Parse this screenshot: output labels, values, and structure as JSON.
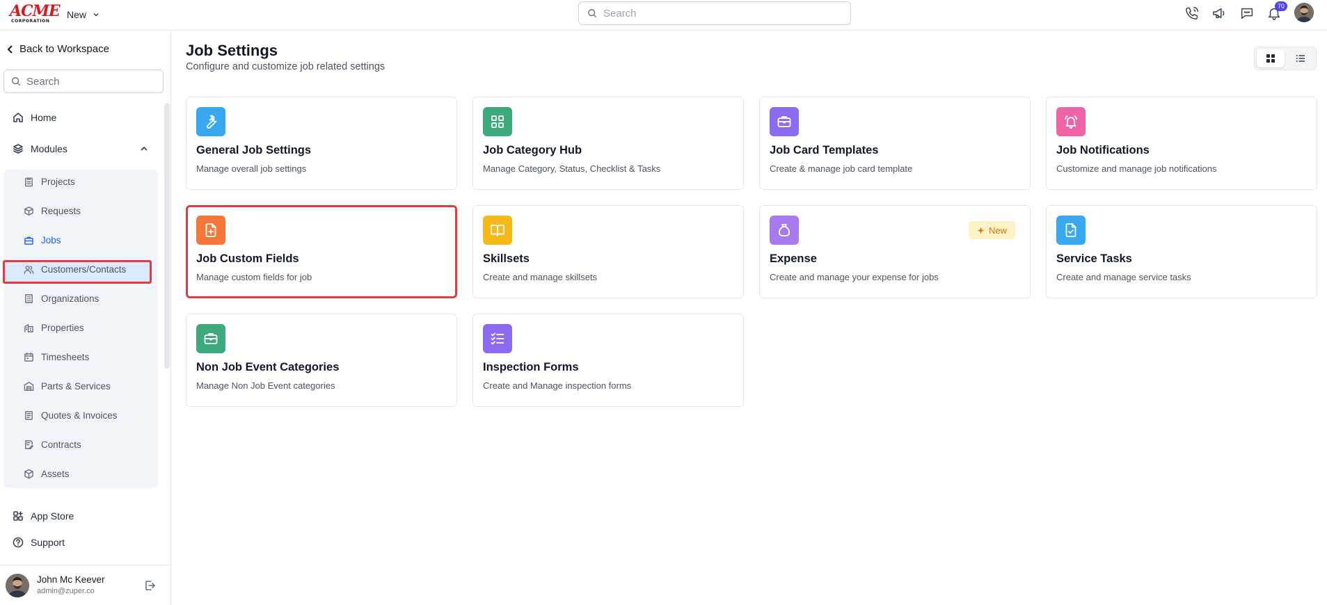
{
  "topbar": {
    "logo_main": "ACME",
    "logo_sub": "CORPORATION",
    "new_label": "New",
    "search_placeholder": "Search",
    "notification_count": "70"
  },
  "sidebar": {
    "back_label": "Back to Workspace",
    "search_placeholder": "Search",
    "home_label": "Home",
    "modules_label": "Modules",
    "modules": [
      {
        "label": "Projects",
        "icon": "clipboard-icon"
      },
      {
        "label": "Requests",
        "icon": "box-icon"
      },
      {
        "label": "Jobs",
        "icon": "briefcase-icon",
        "active": true
      },
      {
        "label": "Customers/Contacts",
        "icon": "users-icon"
      },
      {
        "label": "Organizations",
        "icon": "building-icon"
      },
      {
        "label": "Properties",
        "icon": "property-icon"
      },
      {
        "label": "Timesheets",
        "icon": "calendar-icon"
      },
      {
        "label": "Parts & Services",
        "icon": "warehouse-icon"
      },
      {
        "label": "Quotes & Invoices",
        "icon": "receipt-icon"
      },
      {
        "label": "Contracts",
        "icon": "contract-icon"
      },
      {
        "label": "Assets",
        "icon": "cube-icon"
      }
    ],
    "app_store_label": "App Store",
    "support_label": "Support",
    "user": {
      "name": "John Mc Keever",
      "email": "admin@zuper.co"
    }
  },
  "main": {
    "title": "Job Settings",
    "subtitle": "Configure and customize job related settings",
    "cards": [
      {
        "title": "General Job Settings",
        "desc": "Manage overall job settings",
        "icon": "wrench-icon",
        "color": "#38a9f0"
      },
      {
        "title": "Job Category Hub",
        "desc": "Manage Category, Status, Checklist & Tasks",
        "icon": "grid-icon",
        "color": "#3ea97c"
      },
      {
        "title": "Job Card Templates",
        "desc": "Create & manage job card template",
        "icon": "briefcase-icon",
        "color": "#8b6cf0"
      },
      {
        "title": "Job Notifications",
        "desc": "Customize and manage job notifications",
        "icon": "bell-ring-icon",
        "color": "#ee64a6"
      },
      {
        "title": "Job Custom Fields",
        "desc": "Manage custom fields for job",
        "icon": "file-plus-icon",
        "color": "#f7773b",
        "highlighted": true
      },
      {
        "title": "Skillsets",
        "desc": "Create and manage skillsets",
        "icon": "book-open-icon",
        "color": "#f5b918"
      },
      {
        "title": "Expense",
        "desc": "Create and manage your expense for jobs",
        "icon": "money-bag-icon",
        "color": "#a77af0",
        "badge": "New"
      },
      {
        "title": "Service Tasks",
        "desc": "Create and manage service tasks",
        "icon": "file-check-icon",
        "color": "#38a9f0"
      },
      {
        "title": "Non Job Event Categories",
        "desc": "Manage Non Job Event categories",
        "icon": "briefcase-icon",
        "color": "#3ea97c"
      },
      {
        "title": "Inspection Forms",
        "desc": "Create and Manage inspection forms",
        "icon": "list-checks-icon",
        "color": "#8b6cf0"
      }
    ]
  }
}
